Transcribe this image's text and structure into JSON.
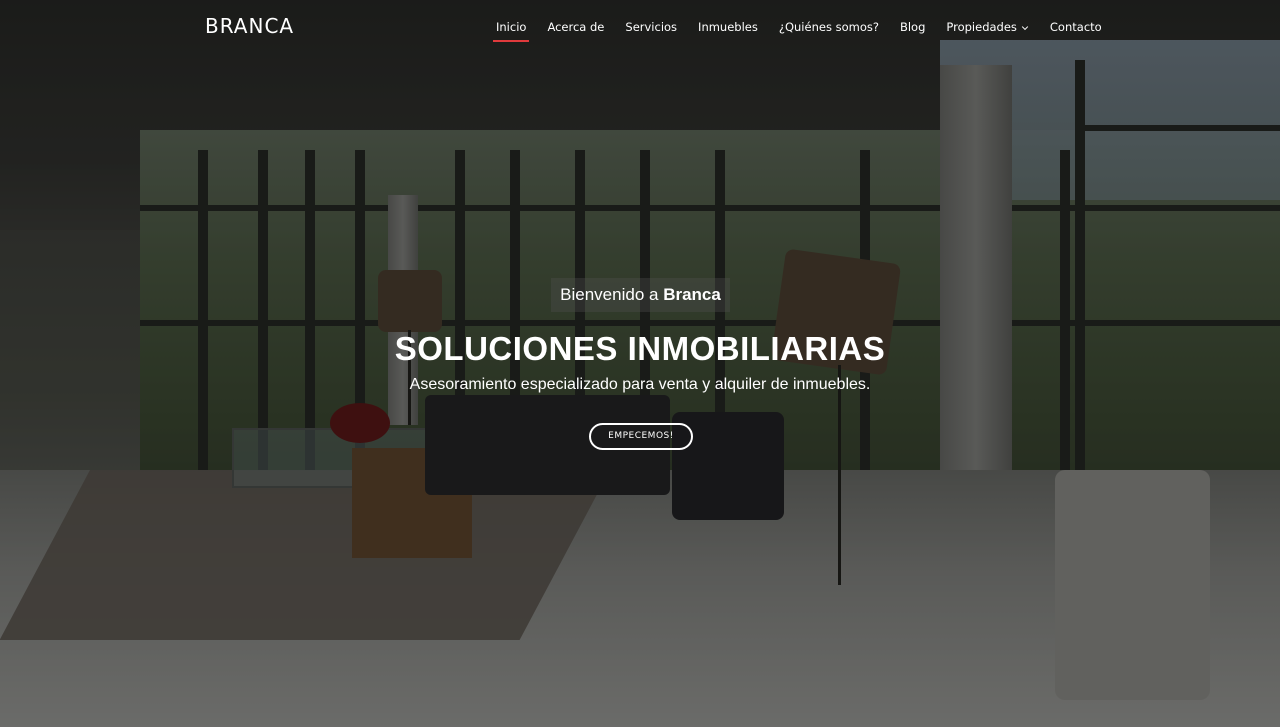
{
  "brand": {
    "name": "BRANCA"
  },
  "nav": {
    "items": [
      {
        "label": "Inicio",
        "active": true
      },
      {
        "label": "Acerca de"
      },
      {
        "label": "Servicios"
      },
      {
        "label": "Inmuebles"
      },
      {
        "label": "¿Quiénes somos?"
      },
      {
        "label": "Blog"
      },
      {
        "label": "Propiedades",
        "dropdown": true,
        "icon": "chevron-down-icon"
      },
      {
        "label": "Contacto"
      }
    ]
  },
  "hero": {
    "welcome_prefix": "Bienvenido a",
    "welcome_name": "Branca",
    "title": "SOLUCIONES INMOBILIARIAS",
    "subtitle": "Asesoramiento especializado para venta y alquiler de inmuebles.",
    "cta_label": "EMPECEMOS!"
  },
  "colors": {
    "accent": "#e03a3c",
    "text": "#ffffff"
  }
}
